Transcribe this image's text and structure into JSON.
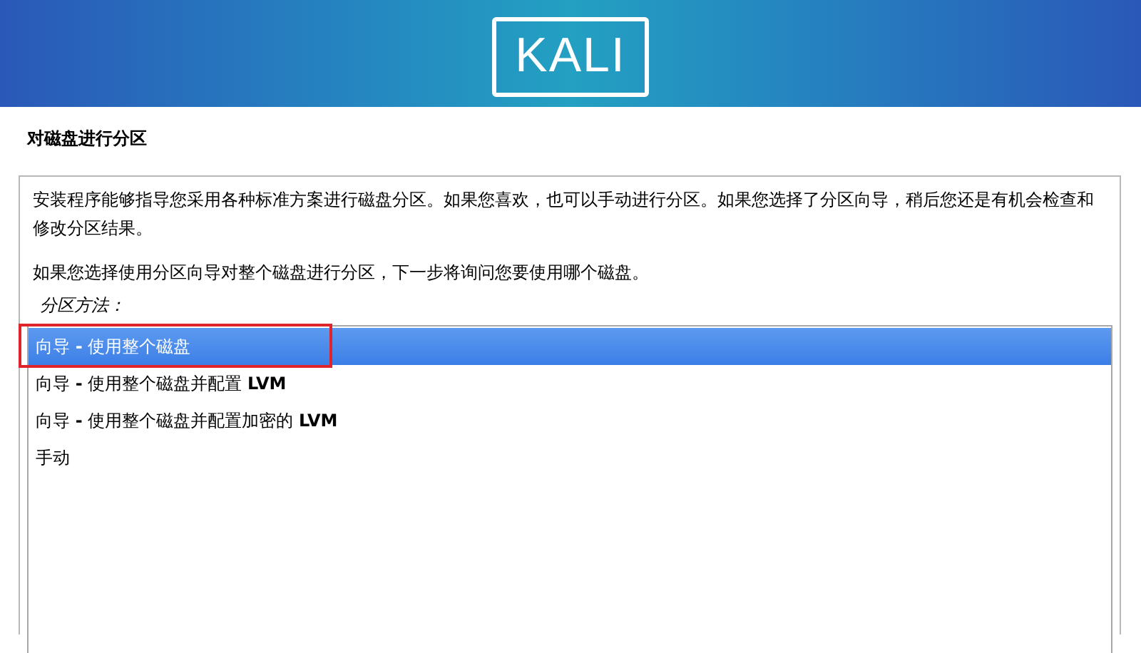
{
  "header": {
    "logo": "KALI"
  },
  "page_title": "对磁盘进行分区",
  "description": [
    "安装程序能够指导您采用各种标准方案进行磁盘分区。如果您喜欢，也可以手动进行分区。如果您选择了分区向导，稍后您还是有机会检查和修改分区结果。",
    "如果您选择使用分区向导对整个磁盘进行分区，下一步将询问您要使用哪个磁盘。"
  ],
  "list_label": "分区方法：",
  "options": [
    {
      "label": "向导 **-** 使用整个磁盘",
      "selected": true,
      "highlighted": true
    },
    {
      "label": "向导 **-** 使用整个磁盘并配置 **LVM**",
      "selected": false,
      "highlighted": false
    },
    {
      "label": "向导 **-** 使用整个磁盘并配置加密的 **LVM**",
      "selected": false,
      "highlighted": false
    },
    {
      "label": "手动",
      "selected": false,
      "highlighted": false
    }
  ]
}
